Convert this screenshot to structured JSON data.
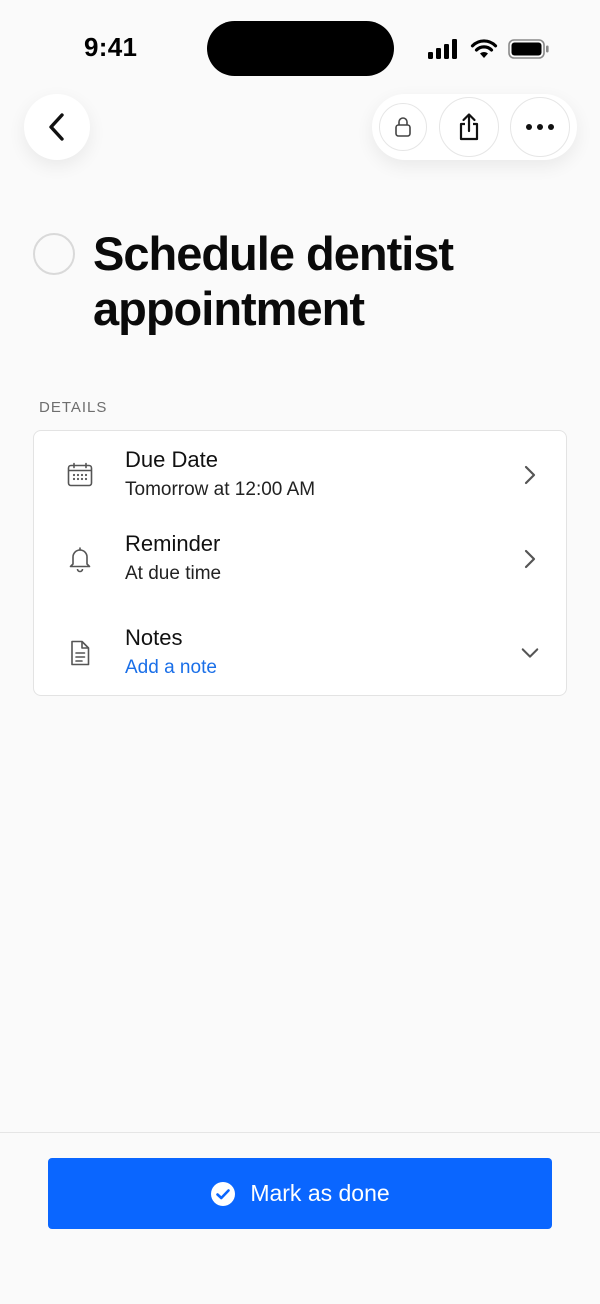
{
  "status_bar": {
    "time": "9:41",
    "icons": [
      "cellular-signal-icon",
      "wifi-icon",
      "battery-icon"
    ]
  },
  "nav": {
    "back_icon": "chevron-left-icon",
    "actions": [
      "lock-icon",
      "share-icon",
      "more-icon"
    ]
  },
  "task": {
    "title": "Schedule dentist appointment",
    "completed": false
  },
  "details": {
    "section_label": "DETAILS",
    "rows": [
      {
        "icon": "calendar-icon",
        "title": "Due Date",
        "value": "Tomorrow at 12:00 AM",
        "accessory": "chevron-right-icon"
      },
      {
        "icon": "bell-icon",
        "title": "Reminder",
        "value": "At due time",
        "accessory": "chevron-right-icon"
      },
      {
        "icon": "document-icon",
        "title": "Notes",
        "value": "Add a note",
        "accessory": "chevron-down-icon"
      }
    ]
  },
  "footer": {
    "primary_label": "Mark as done",
    "primary_icon": "check-circle-icon"
  },
  "colors": {
    "accent": "#0a66ff",
    "link": "#1a6fe8",
    "background": "#fafafa"
  }
}
